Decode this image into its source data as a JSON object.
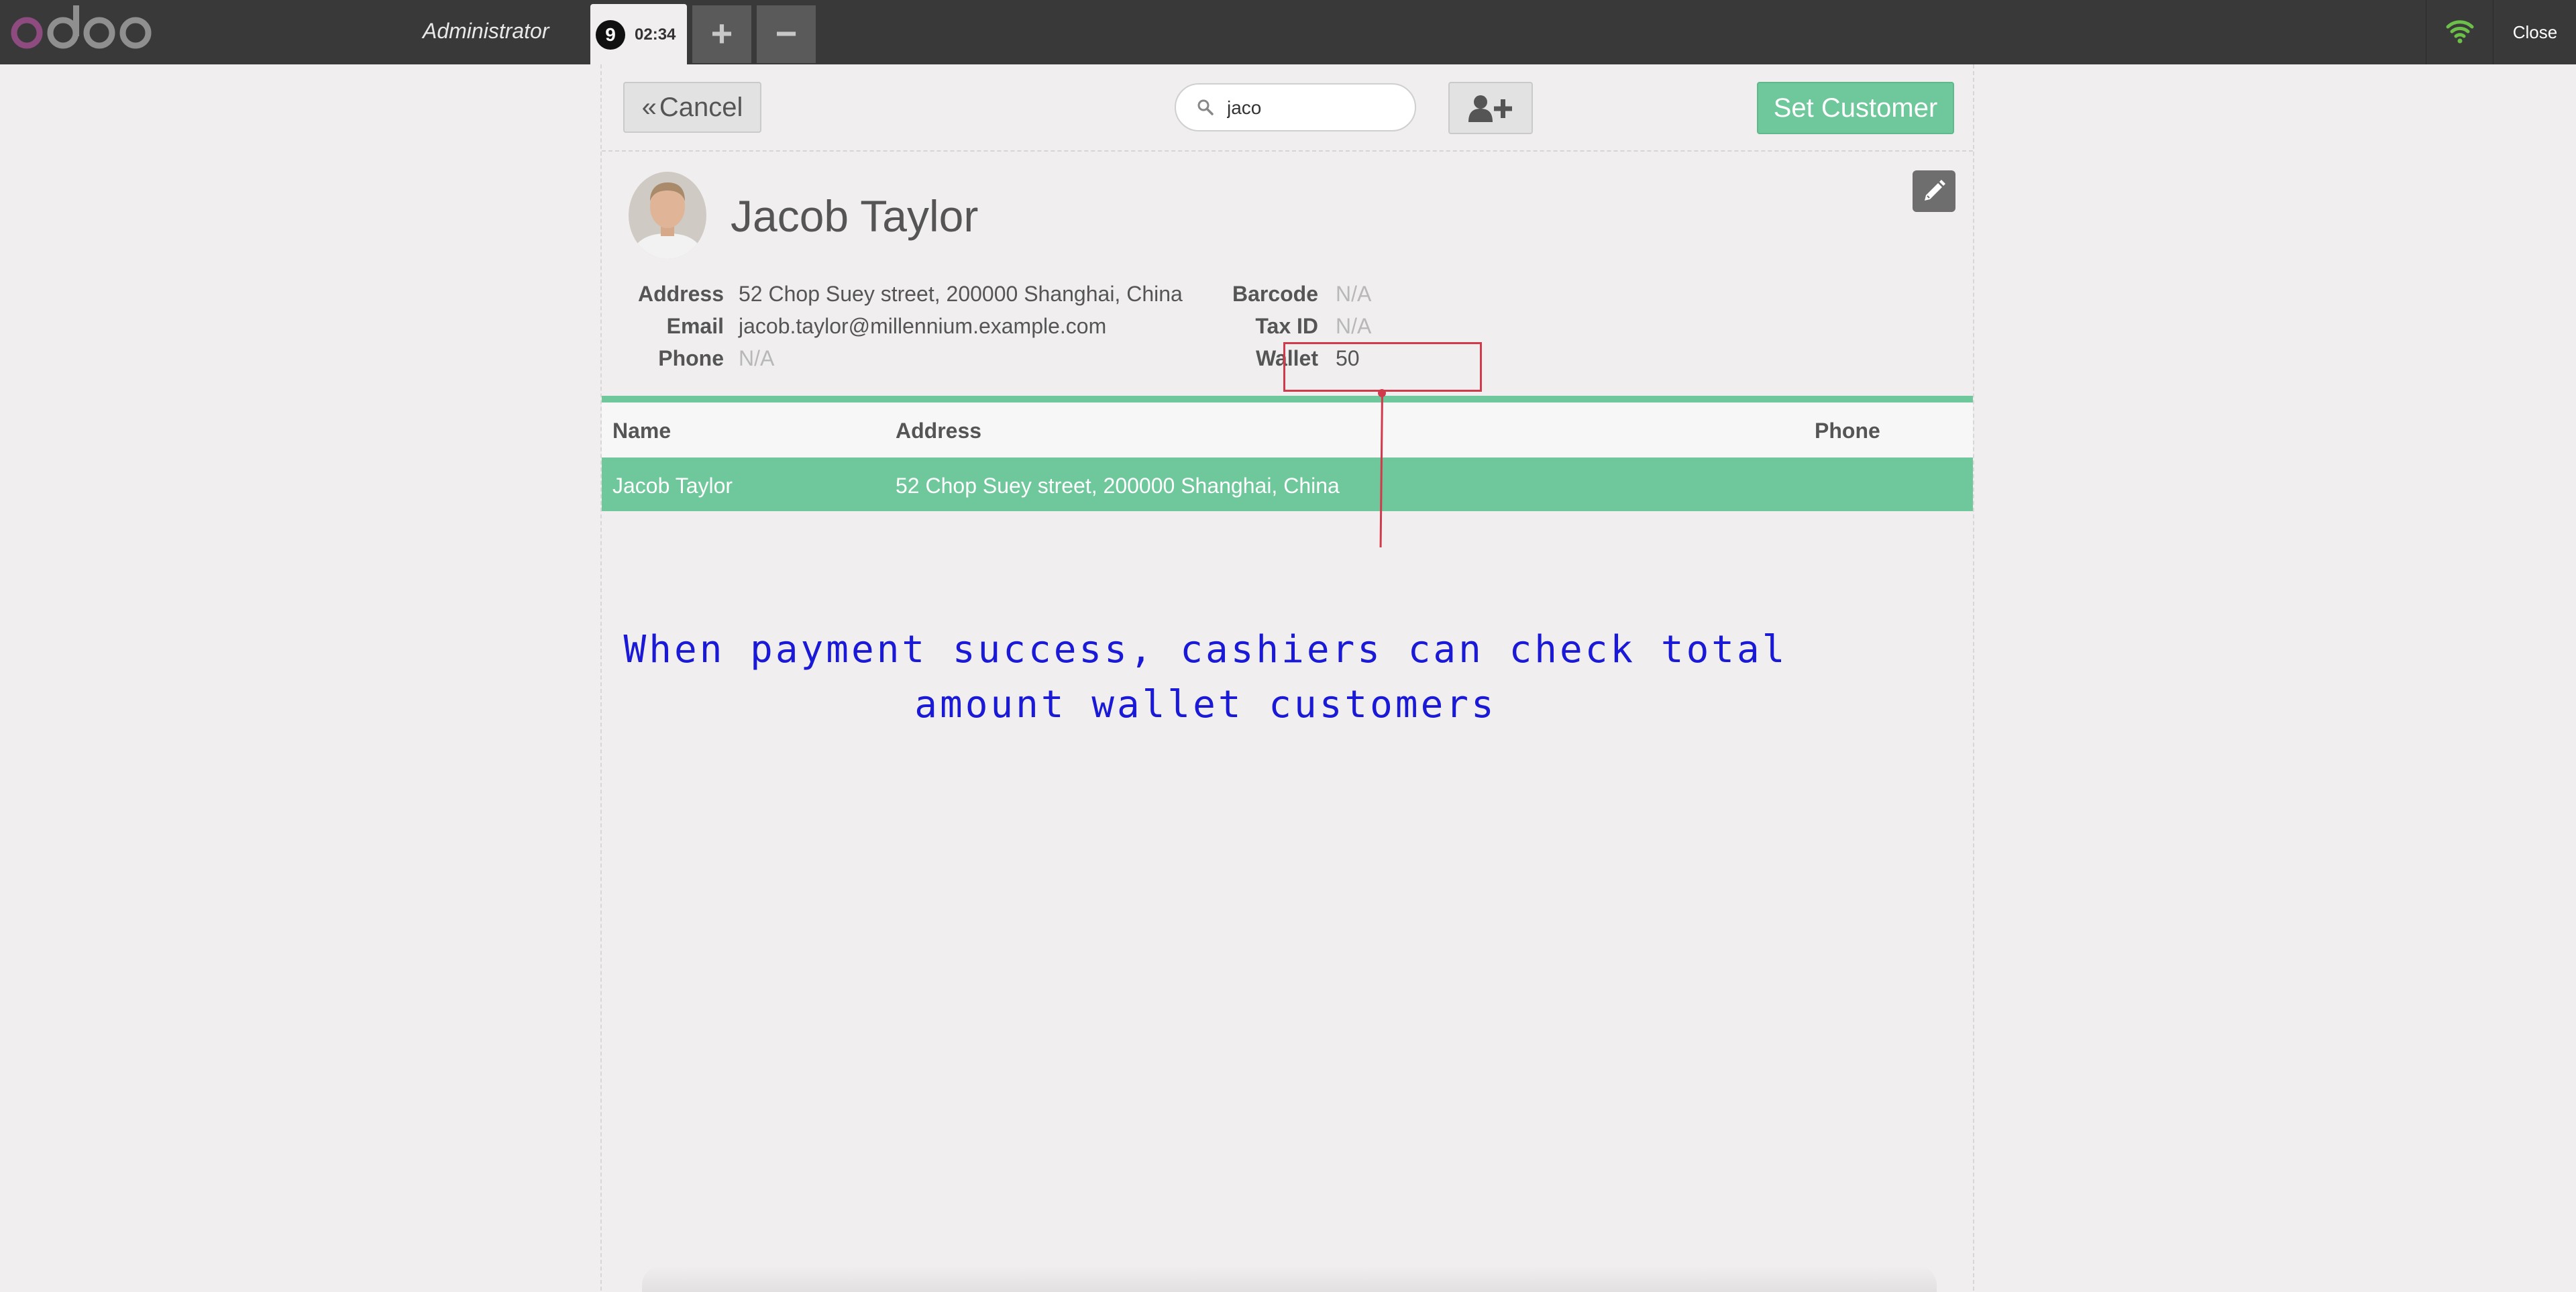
{
  "topbar": {
    "logo_text": "odoo",
    "user_name": "Administrator",
    "order": {
      "number": "9",
      "time": "02:34"
    },
    "add_order_label": "+",
    "remove_order_label": "−",
    "close_label": "Close"
  },
  "controls": {
    "cancel_label": "Cancel",
    "search_value": "jaco",
    "set_customer_label": "Set Customer"
  },
  "client": {
    "name": "Jacob Taylor",
    "details_left": [
      {
        "label": "Address",
        "value": "52 Chop Suey street, 200000 Shanghai, China"
      },
      {
        "label": "Email",
        "value": "jacob.taylor@millennium.example.com"
      },
      {
        "label": "Phone",
        "value": "N/A"
      }
    ],
    "details_right": [
      {
        "label": "Barcode",
        "value": "N/A"
      },
      {
        "label": "Tax ID",
        "value": "N/A"
      },
      {
        "label": "Wallet",
        "value": "50"
      }
    ]
  },
  "list": {
    "columns": [
      "Name",
      "Address",
      "Phone"
    ],
    "rows": [
      {
        "name": "Jacob Taylor",
        "address": "52 Chop Suey street, 200000 Shanghai, China",
        "phone": ""
      }
    ]
  },
  "annotation": {
    "line1": "When payment success, cashiers can check total",
    "line2": "amount wallet customers"
  },
  "colors": {
    "accent": "#6ec89b",
    "topbar": "#393939",
    "callout": "#d03a4a",
    "annotation": "#1a1ad6"
  },
  "icons": [
    "odoo-logo",
    "wifi-icon",
    "search-icon",
    "add-user-icon",
    "pencil-icon",
    "double-chevron-left-icon"
  ]
}
